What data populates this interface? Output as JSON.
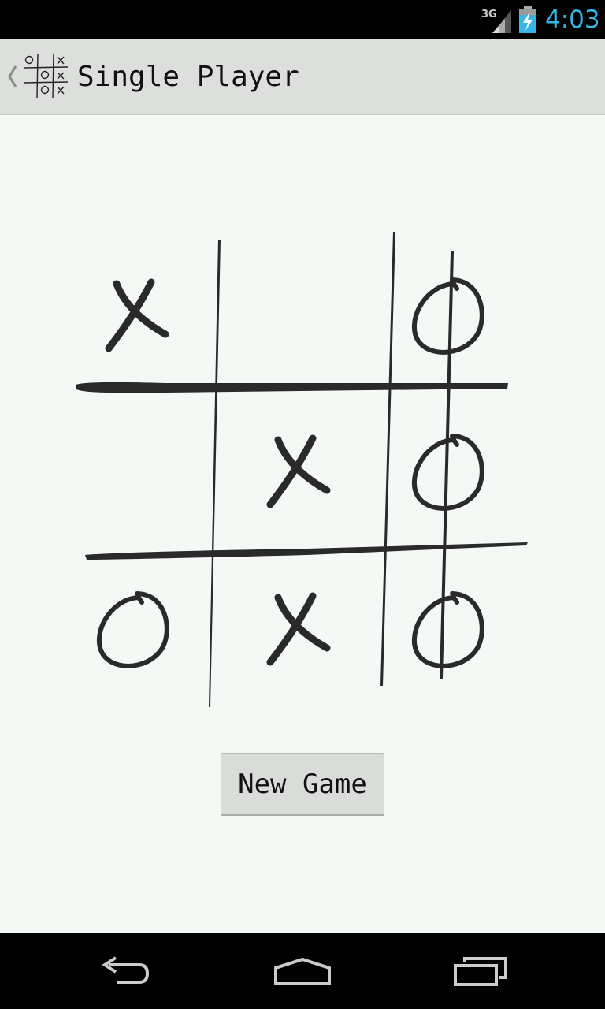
{
  "status_bar": {
    "network_label": "3G",
    "time": "4:03",
    "icons": [
      "signal-icon",
      "battery-charging-icon"
    ],
    "accent_color": "#35b6e6"
  },
  "action_bar": {
    "title": "Single Player",
    "up_icon": "back-caret-icon",
    "app_icon": "tic-tac-toe-icon"
  },
  "board": {
    "cells": [
      [
        "X",
        "",
        "O"
      ],
      [
        "",
        "X",
        "O"
      ],
      [
        "O",
        "X",
        "O"
      ]
    ],
    "winning_line": "column-3"
  },
  "controls": {
    "new_game_label": "New Game"
  },
  "nav_bar": {
    "buttons": [
      "back-icon",
      "home-icon",
      "recent-apps-icon"
    ]
  }
}
